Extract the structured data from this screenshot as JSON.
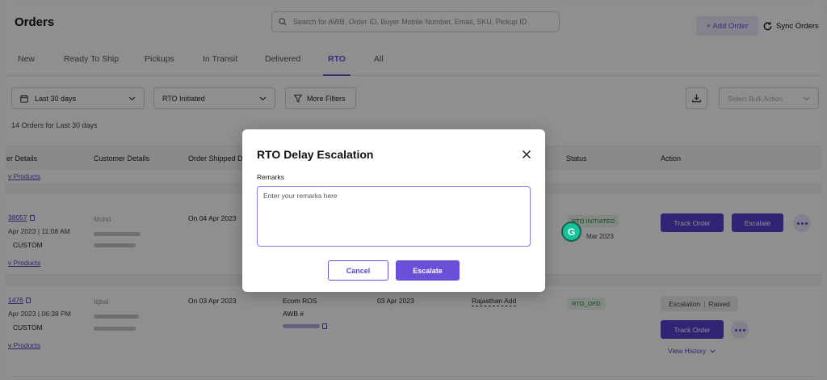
{
  "app": {
    "title": "Orders"
  },
  "search": {
    "placeholder": "Search for AWB, Order ID, Buyer Mobile Number, Email, SKU, Pickup ID"
  },
  "header": {
    "add_order": "+ Add Order",
    "sync_orders": "Sync Orders"
  },
  "tabs": [
    {
      "label": "New"
    },
    {
      "label": "Ready To Ship"
    },
    {
      "label": "Pickups"
    },
    {
      "label": "In Transit"
    },
    {
      "label": "Delivered"
    },
    {
      "label": "RTO",
      "active": true
    },
    {
      "label": "All"
    }
  ],
  "filters": {
    "date_range": "Last 30 days",
    "status": "RTO Initiated",
    "more_filters": "More Filters",
    "bulk_action_placeholder": "Select Bulk Action"
  },
  "summary": {
    "count_text": "14 Orders for Last 30 days"
  },
  "table": {
    "headers": {
      "order_details": "er Details",
      "customer_details": "Customer Details",
      "order_shipped": "Order Shipped Da",
      "status": "Status",
      "action": "Action"
    },
    "top_row": {
      "view_products": "v Products"
    },
    "rows": [
      {
        "order_id": "38057",
        "order_time": "Apr 2023 | 11:08 AM",
        "channel": "CUSTOM",
        "view_products": "v Products",
        "customer_name": "Mohd",
        "shipped_date": "On 04 Apr 2023",
        "status": "RTO INITIATED",
        "status_date": "Mar 2023",
        "track_label": "Track Order",
        "escalate_label": "Escalate"
      },
      {
        "order_id": "1476",
        "order_time": "Apr 2023 | 06:38 PM",
        "channel": "CUSTOM",
        "view_products": "v Products",
        "customer_name": "Iqbal",
        "shipped_date": "On 03 Apr 2023",
        "courier": "Ecom ROS",
        "awb_label": "AWB #",
        "pickup_date": "03 Apr 2023",
        "address": "Rajasthan Add",
        "status": "RTO_OFD",
        "escalation_label": "Escalation",
        "escalation_state": "Raised",
        "track_label": "Track Order",
        "view_history": "View History"
      }
    ]
  },
  "modal": {
    "title": "RTO Delay Escalation",
    "remarks_label": "Remarks",
    "remarks_value": "",
    "remarks_placeholder": "Enter your remarks here",
    "cancel_label": "Cancel",
    "escalate_label": "Escalate"
  },
  "grammarly": {
    "glyph": "G"
  },
  "colors": {
    "accent": "#6b4fd8",
    "accent_light": "#ece8fb",
    "status_green": "#2e7d32",
    "overlay": "rgba(0,0,0,0.44)"
  }
}
